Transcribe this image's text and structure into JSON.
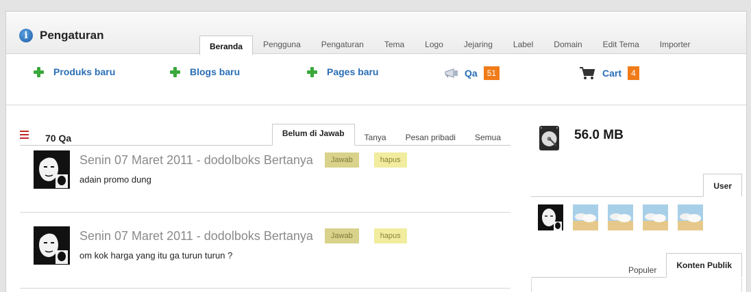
{
  "header": {
    "title": "Pengaturan",
    "tabs": [
      {
        "label": "Beranda",
        "active": true
      },
      {
        "label": "Pengguna",
        "active": false
      },
      {
        "label": "Pengaturan",
        "active": false
      },
      {
        "label": "Tema",
        "active": false
      },
      {
        "label": "Logo",
        "active": false
      },
      {
        "label": "Jejaring",
        "active": false
      },
      {
        "label": "Label",
        "active": false
      },
      {
        "label": "Domain",
        "active": false
      },
      {
        "label": "Edit Tema",
        "active": false
      },
      {
        "label": "Importer",
        "active": false
      }
    ]
  },
  "actions": {
    "produk": "Produks baru",
    "blog": "Blogs baru",
    "page": "Pages baru",
    "qa": {
      "label": "Qa",
      "count": "51"
    },
    "cart": {
      "label": "Cart",
      "count": "4"
    }
  },
  "qa": {
    "title": "70 Qa",
    "tabs": [
      {
        "label": "Belum di Jawab",
        "active": true
      },
      {
        "label": "Tanya",
        "active": false
      },
      {
        "label": "Pesan pribadi",
        "active": false
      },
      {
        "label": "Semua",
        "active": false
      }
    ],
    "items": [
      {
        "header": "Senin 07 Maret 2011 - dodolboks Bertanya",
        "text": "adain promo dung",
        "answer_label": "Jawab",
        "delete_label": "hapus"
      },
      {
        "header": "Senin 07 Maret 2011 - dodolboks Bertanya",
        "text": "om kok harga yang itu ga turun turun ?",
        "answer_label": "Jawab",
        "delete_label": "hapus"
      }
    ]
  },
  "storage": {
    "value": "56.0 MB"
  },
  "users": {
    "tab": "User"
  },
  "content": {
    "tabs": [
      {
        "label": "Populer",
        "active": false
      },
      {
        "label": "Konten Publik",
        "active": true
      }
    ]
  },
  "colors": {
    "accent": "#2a6eb5",
    "badge": "#f07b18",
    "plus": "#3aa83a",
    "menu": "#c0282d"
  }
}
